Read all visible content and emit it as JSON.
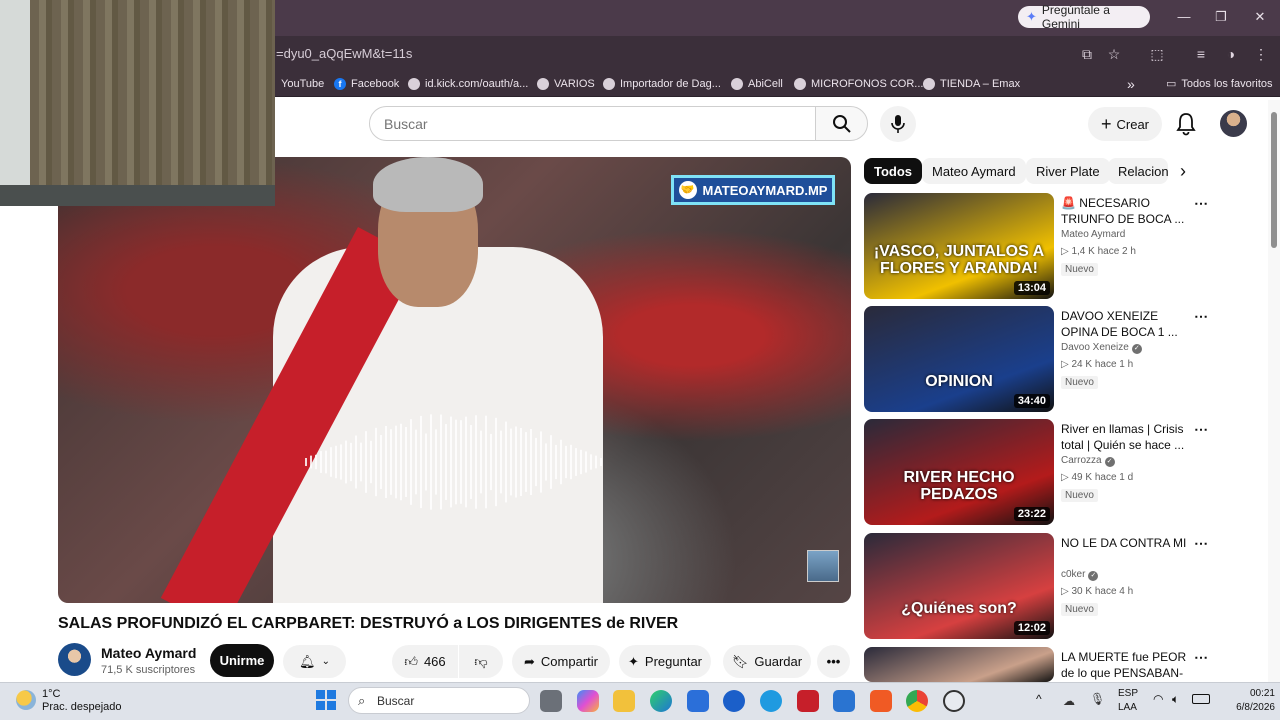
{
  "browser": {
    "gemini_label": "Pregúntale a Gemini",
    "url_fragment": "=dyu0_aQqEwM&t=11s",
    "bookmarks": [
      "YouTube",
      "Facebook",
      "id.kick.com/oauth/a...",
      "VARIOS",
      "Importador de Dag...",
      "AbiCell",
      "MICROFONOS COR...",
      "TIENDA – Emax"
    ],
    "bookmarks_overflow": "»",
    "all_bookmarks": "Todos los favoritos"
  },
  "youtube": {
    "search_placeholder": "Buscar",
    "create_label": "Crear",
    "player": {
      "overlay_badge": "MATEOAYMARD.MP"
    },
    "video": {
      "title": "SALAS PROFUNDIZÓ EL CARPBARET: DESTRUYÓ a LOS DIRIGENTES de RIVER",
      "channel_name": "Mateo Aymard",
      "subscribers": "71,5 K suscriptores",
      "join_label": "Unirme",
      "likes": "466",
      "share_label": "Compartir",
      "ask_label": "Preguntar",
      "save_label": "Guardar"
    },
    "chips": [
      "Todos",
      "Mateo Aymard",
      "River Plate",
      "Relacion"
    ],
    "recommendations": [
      {
        "title": "🚨 NECESARIO TRIUNFO DE BOCA ...",
        "channel": "Mateo Aymard",
        "verified": false,
        "meta": "▷ 1,4 K  hace 2 h",
        "badge": "Nuevo",
        "duration": "13:04",
        "thumb_text": "¡VASCO, JUNTALOS A FLORES Y ARANDA!",
        "accent": "#f0c000"
      },
      {
        "title": "DAVOO XENEIZE OPINA DE BOCA 1 ...",
        "channel": "Davoo Xeneize",
        "verified": true,
        "meta": "▷ 24 K  hace 1 h",
        "badge": "Nuevo",
        "duration": "34:40",
        "thumb_text": "OPINION",
        "accent": "#1a3f8c"
      },
      {
        "title": "River en llamas | Crisis total | Quién se hace ...",
        "channel": "Carrozza",
        "verified": true,
        "meta": "▷ 49 K  hace 1 d",
        "badge": "Nuevo",
        "duration": "23:22",
        "thumb_text": "RIVER HECHO PEDAZOS",
        "accent": "#b31b1b"
      },
      {
        "title": "NO LE DA CONTRA MI",
        "channel": "c0ker",
        "verified": true,
        "meta": "▷ 30 K  hace 4 h",
        "badge": "Nuevo",
        "duration": "12:02",
        "thumb_text": "¿Quiénes son?",
        "accent": "#d64040"
      },
      {
        "title": "LA MUERTE fue PEOR de lo que PENSABAN- ...",
        "channel": "",
        "verified": false,
        "meta": "",
        "badge": "",
        "duration": "",
        "thumb_text": "",
        "accent": "#c9a08a"
      }
    ]
  },
  "taskbar": {
    "temperature": "1°C",
    "weather": "Prac. despejado",
    "search_placeholder": "Buscar",
    "lang_line1": "ESP",
    "lang_line2": "LAA",
    "time": "00:21",
    "date": "6/8/2026"
  }
}
